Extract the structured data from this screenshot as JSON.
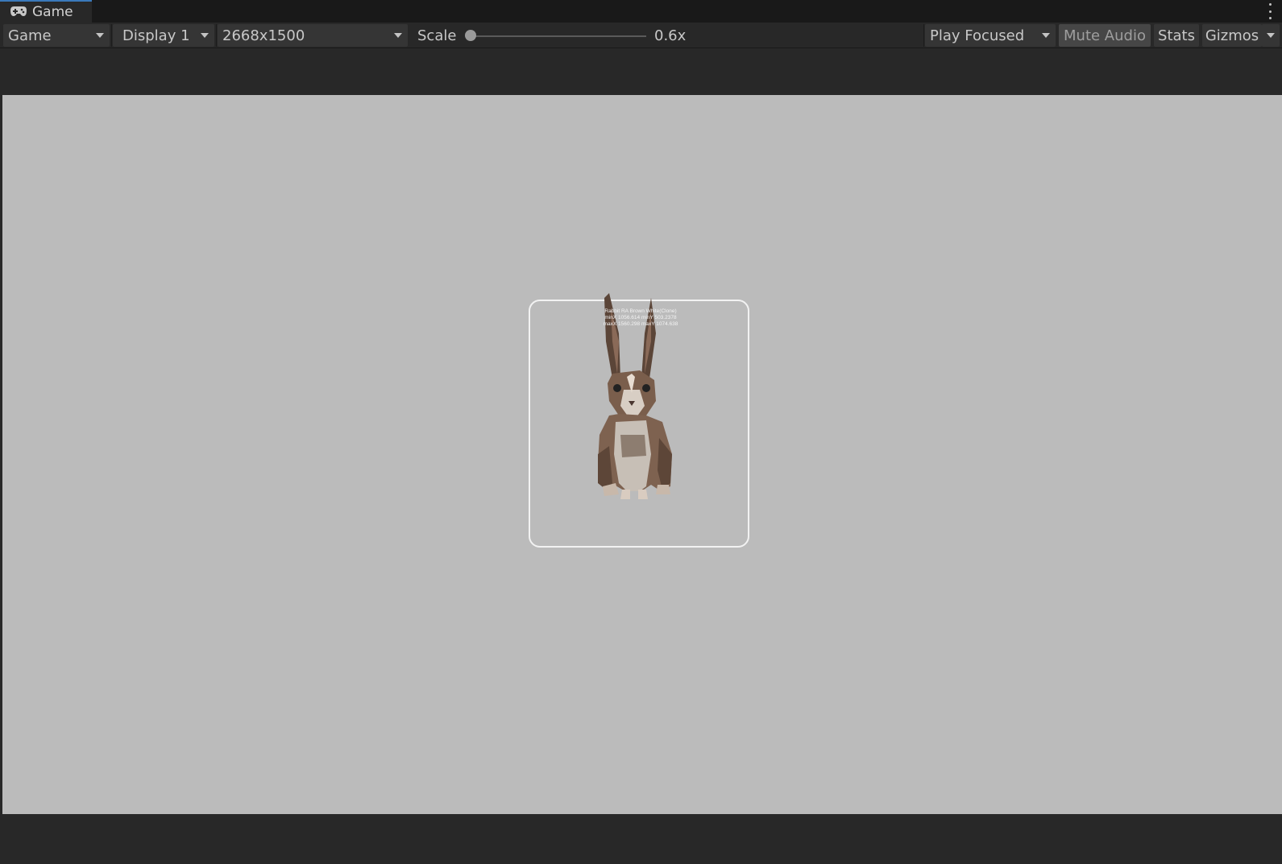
{
  "window": {
    "tab_label": "Game",
    "tab_icon": "gamepad-icon",
    "menu_icon": "kebab-menu-icon"
  },
  "toolbar": {
    "view_mode": "Game",
    "display": "Display 1",
    "resolution": "2668x1500",
    "scale_label": "Scale",
    "scale_value": "0.6x",
    "scale_level": 0.0,
    "play_mode": "Play Focused",
    "mute_audio": "Mute Audio",
    "mute_audio_active": true,
    "stats": "Stats",
    "gizmos": "Gizmos"
  },
  "scene": {
    "background_color": "#bbbbbb",
    "panel_border_color": "#f2f2f2",
    "debug_lines": [
      "Rabbit RA Brown White(Clone)",
      "minX 1056.614 minY 503.2378",
      "maxX 1560.298 maxY 1074.638"
    ],
    "object": "rabbit-model"
  },
  "colors": {
    "toolbar_bg": "#282828",
    "button_bg": "#353535",
    "active_button_bg": "#464646",
    "tab_accent": "#3a79bb"
  }
}
